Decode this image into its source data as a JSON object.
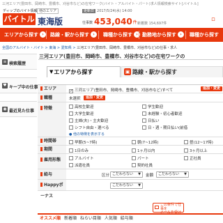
{
  "header": {
    "top_text": "三河エリア(豊田市、岡崎市、豊橋市、刈谷市など)の在宅ワーク(バイト・アルバイト・パート)求人情報検索サイト[バイトル]",
    "brand_tagline": "ディップのバイト情報",
    "logo": "バイトル",
    "region_tag": "他のエリア",
    "region": "東海版",
    "update_label": "更新日",
    "update_value": "2017/5/24(水) 14:00",
    "jobs_label": "仕事数",
    "jobs_count": "453,040",
    "jobs_unit": "件",
    "new_label": "新着数",
    "new_count": "154,697件",
    "link": "ロ"
  },
  "nav": {
    "items": [
      "エリアから探す",
      "路線・駅から探す",
      "職種から探す",
      "勤務地から探す",
      "職種から探す"
    ]
  },
  "breadcrumb": {
    "items": [
      "全国のアルバイト・バイト",
      "東海",
      "愛知県"
    ],
    "current": "三河エリア(豊田市、岡崎市、豊橋市、刈谷市など)の仕事・求人"
  },
  "sidebar": {
    "items": [
      {
        "label": "検索履歴",
        "icon": "history-icon"
      },
      {
        "label": "キープ中の仕事",
        "icon": "heart-icon"
      },
      {
        "label": "最近見た仕事",
        "icon": "eye-icon"
      }
    ]
  },
  "main": {
    "title": "三河エリア(豊田市、岡崎市、豊橋市、刈谷市など)の在宅ワークの",
    "tabs": [
      {
        "label": "エリアから探す",
        "icon": "triangle-down-icon"
      },
      {
        "label": "路線・駅から探す",
        "icon": "train-icon"
      }
    ]
  },
  "form": {
    "area": {
      "label": "エリア",
      "value": "三河エリア(豊田市、岡崎市、豊橋市、刈谷市など)すべて",
      "button": "追加・変更"
    },
    "shokushu": {
      "label": "職種",
      "value": "未選択",
      "button": "追加・変更"
    },
    "tokucho": {
      "label": "特徴",
      "options": [
        "高校生歓迎",
        "学生歓迎",
        "大学生歓迎",
        "未経験・初心者歓迎",
        "主婦(夫)・主夫歓迎",
        "日払い",
        "シフト自由・選べる",
        "日・週・期日払い(前借"
      ],
      "more_link": "● 他の特徴を表示する"
    },
    "jikantai": {
      "label": "時間帯",
      "options": [
        "早朝(5~7時)",
        "朝(7~12時)",
        "昼(12~17時)"
      ]
    },
    "kikan": {
      "label": "期間",
      "options": [
        "1日のみ",
        "1ヶ月以内",
        "3ヶ月以上"
      ]
    },
    "koyo": {
      "label": "雇用形態",
      "options": [
        "アルバイト",
        "パート",
        "正社員",
        "派遣社員",
        "契約社員"
      ]
    },
    "kyuyo": {
      "label": "給与",
      "kubun_label": "区分",
      "select1": "こだわらない",
      "kingaku_label": "金額",
      "select2": "こだわらない"
    },
    "happy": {
      "label": "Happyボーナス",
      "select": "こだわらない"
    },
    "mail_button": "この条件で仕事を\nメールを受け取る"
  },
  "bottom_tabs": {
    "items": [
      "オススメ順",
      "新着順",
      "ねらい目順",
      "人気順",
      "給与順"
    ]
  }
}
